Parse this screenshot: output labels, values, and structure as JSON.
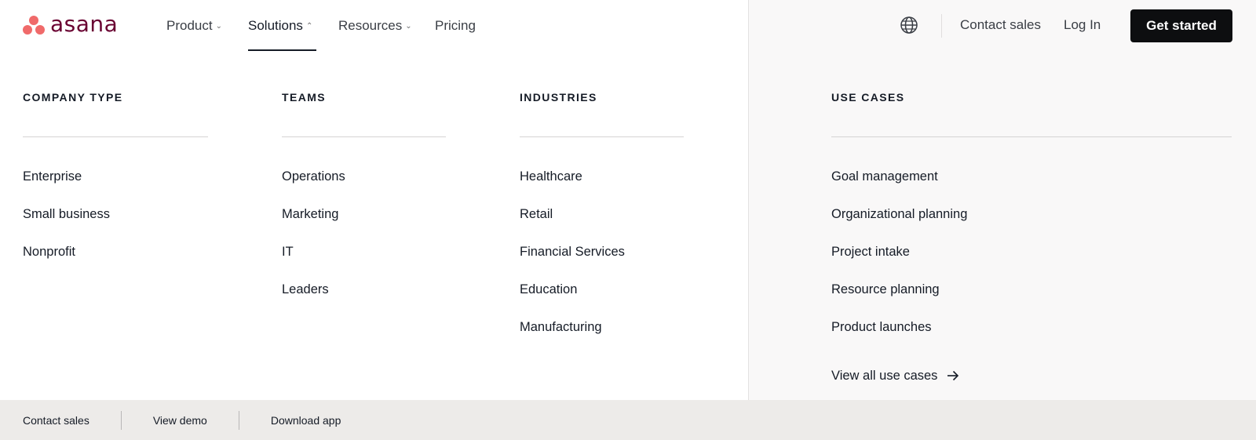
{
  "brand": {
    "name": "asana",
    "dot_color": "#f06a6a",
    "text_color": "#690031"
  },
  "nav": {
    "items": [
      {
        "label": "Product",
        "chevron": "⌄"
      },
      {
        "label": "Solutions",
        "chevron": "⌃",
        "active": true
      },
      {
        "label": "Resources",
        "chevron": "⌄"
      },
      {
        "label": "Pricing"
      }
    ],
    "globe_icon": "globe-icon",
    "contact_sales": "Contact sales",
    "log_in": "Log In",
    "get_started": "Get started"
  },
  "menu": {
    "company_type": {
      "heading": "COMPANY TYPE",
      "items": [
        "Enterprise",
        "Small business",
        "Nonprofit"
      ]
    },
    "teams": {
      "heading": "TEAMS",
      "items": [
        "Operations",
        "Marketing",
        "IT",
        "Leaders"
      ]
    },
    "industries": {
      "heading": "INDUSTRIES",
      "items": [
        "Healthcare",
        "Retail",
        "Financial Services",
        "Education",
        "Manufacturing"
      ]
    },
    "use_cases": {
      "heading": "USE CASES",
      "items": [
        "Goal management",
        "Organizational planning",
        "Project intake",
        "Resource planning",
        "Product launches"
      ],
      "view_all": "View all use cases",
      "view_all_icon": "arrow-right-icon"
    }
  },
  "footer": {
    "contact_sales": "Contact sales",
    "view_demo": "View demo",
    "download_app": "Download app"
  }
}
